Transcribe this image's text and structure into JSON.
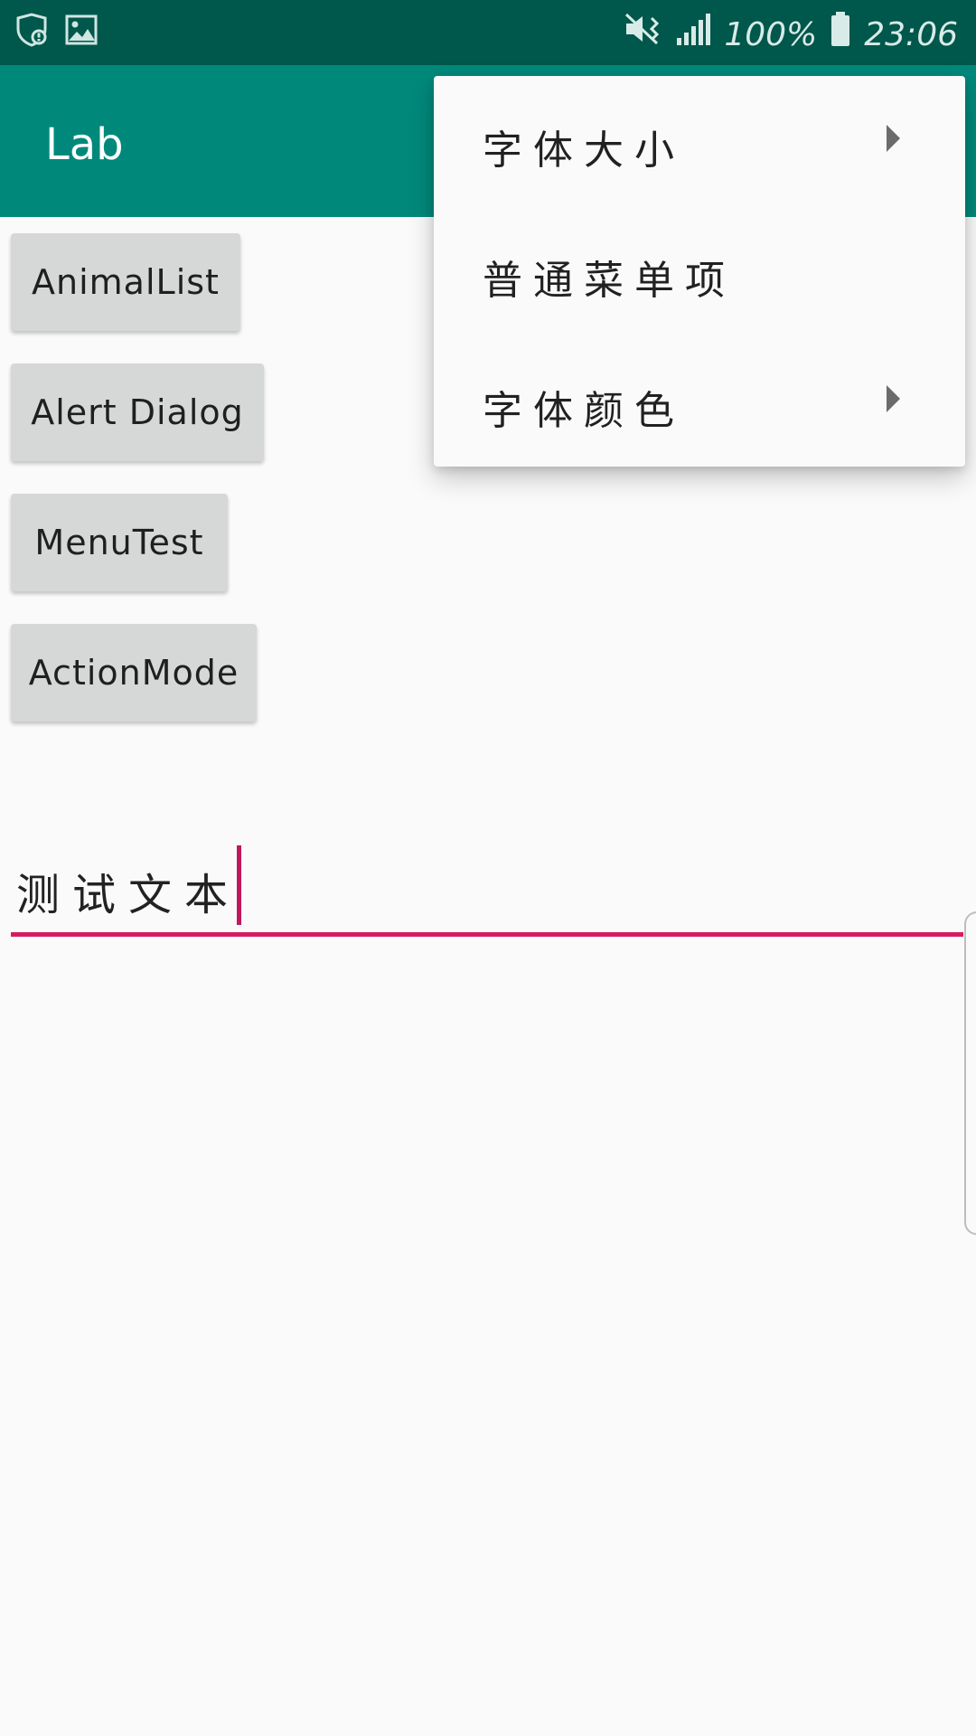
{
  "status_bar": {
    "left_icons": [
      "shield-check-icon",
      "image-icon"
    ],
    "right_icons": [
      "vibrate-mute-icon",
      "signal-icon",
      "battery-icon"
    ],
    "battery_text": "100%",
    "time": "23:06"
  },
  "app_bar": {
    "title": "Lab"
  },
  "buttons": [
    {
      "label": "AnimalList"
    },
    {
      "label": "Alert Dialog"
    },
    {
      "label": "MenuTest"
    },
    {
      "label": "ActionMode"
    }
  ],
  "edit_text": {
    "value": "测试文本"
  },
  "popup_menu": {
    "items": [
      {
        "label": "字体大小",
        "has_submenu": true
      },
      {
        "label": "普通菜单项",
        "has_submenu": false
      },
      {
        "label": "字体颜色",
        "has_submenu": true
      }
    ]
  },
  "colors": {
    "status_bar": "#00574b",
    "app_bar": "#00897b",
    "accent": "#d81b60",
    "button_bg": "#d6d7d7",
    "background": "#fafafa"
  }
}
